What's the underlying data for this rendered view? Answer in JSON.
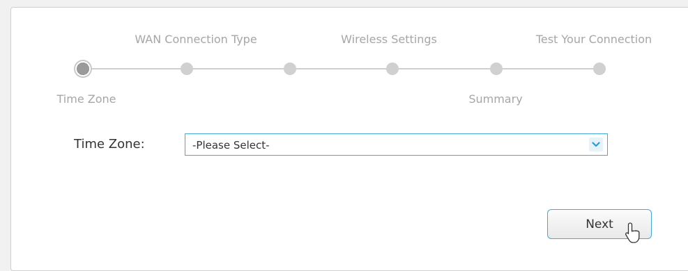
{
  "wizard": {
    "steps_top": [
      "WAN Connection Type",
      "Wireless Settings",
      "Test Your Connection"
    ],
    "steps_bottom": [
      "Time Zone",
      "Summary"
    ],
    "current_step": "Time Zone"
  },
  "form": {
    "time_zone_label": "Time Zone:",
    "time_zone_value": "-Please Select-"
  },
  "buttons": {
    "next_label": "Next"
  },
  "colors": {
    "accent": "#41a9d8",
    "step_inactive": "#d0d0d0",
    "step_active": "#9a9a9a"
  },
  "icons": {
    "select_arrow": "chevron-down-icon",
    "cursor": "mouse-pointer-icon"
  }
}
